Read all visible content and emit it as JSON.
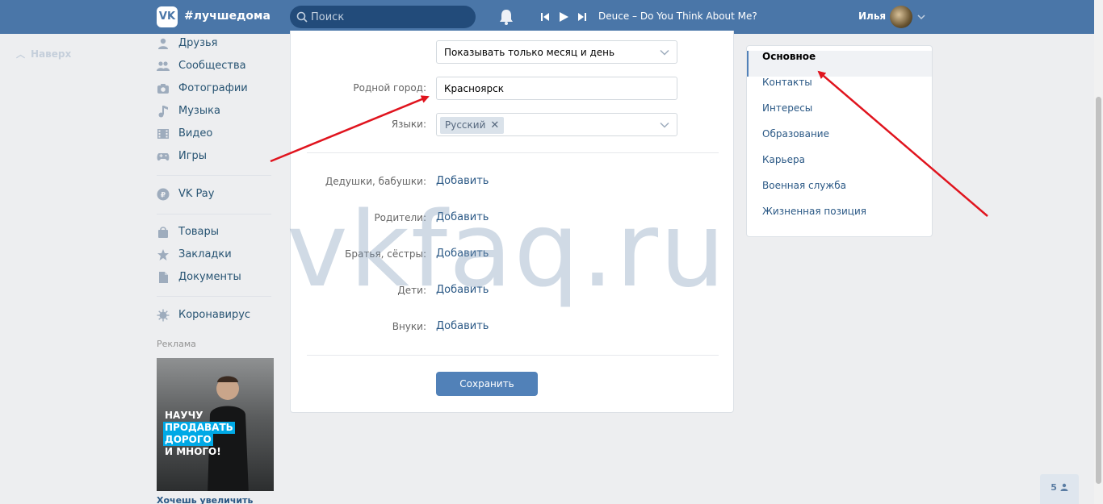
{
  "header": {
    "logo_text": "VK",
    "hashtag": "#лучшедома",
    "search_placeholder": "Поиск",
    "track": "Deuce – Do You Think About Me?",
    "user_name": "Илья"
  },
  "up_link": {
    "label": "Наверх"
  },
  "nav": [
    {
      "label": "Друзья",
      "icon": "friends-icon"
    },
    {
      "label": "Сообщества",
      "icon": "groups-icon"
    },
    {
      "label": "Фотографии",
      "icon": "camera-icon"
    },
    {
      "label": "Музыка",
      "icon": "music-icon"
    },
    {
      "label": "Видео",
      "icon": "video-icon"
    },
    {
      "label": "Игры",
      "icon": "gamepad-icon"
    },
    {
      "label": "VK Pay",
      "icon": "vkpay-icon"
    },
    {
      "label": "Товары",
      "icon": "bag-icon"
    },
    {
      "label": "Закладки",
      "icon": "star-icon"
    },
    {
      "label": "Документы",
      "icon": "document-icon"
    },
    {
      "label": "Коронавирус",
      "icon": "virus-icon"
    }
  ],
  "ads": {
    "title": "Реклама",
    "lines": [
      "НАУЧУ",
      "ПРОДАВАТЬ",
      "ДОРОГО",
      "И МНОГО!"
    ],
    "caption": "Хочешь увеличить"
  },
  "form": {
    "birthday_visibility": "Показывать только месяц и день",
    "hometown_label": "Родной город:",
    "hometown_value": "Красноярск",
    "languages_label": "Языки:",
    "language_chip": "Русский",
    "relatives": [
      {
        "label": "Дедушки, бабушки:",
        "action": "Добавить"
      },
      {
        "label": "Родители:",
        "action": "Добавить"
      },
      {
        "label": "Братья, сёстры:",
        "action": "Добавить"
      },
      {
        "label": "Дети:",
        "action": "Добавить"
      },
      {
        "label": "Внуки:",
        "action": "Добавить"
      }
    ],
    "save_label": "Сохранить"
  },
  "right_menu": [
    {
      "label": "Основное",
      "active": true
    },
    {
      "label": "Контакты",
      "active": false
    },
    {
      "label": "Интересы",
      "active": false
    },
    {
      "label": "Образование",
      "active": false
    },
    {
      "label": "Карьера",
      "active": false
    },
    {
      "label": "Военная служба",
      "active": false
    },
    {
      "label": "Жизненная позиция",
      "active": false
    }
  ],
  "watermark": "vkfaq.ru",
  "badge": "5",
  "colors": {
    "header": "#4a76a8",
    "link": "#2a5885",
    "button": "#5181b8",
    "arrow": "#e0141e"
  }
}
